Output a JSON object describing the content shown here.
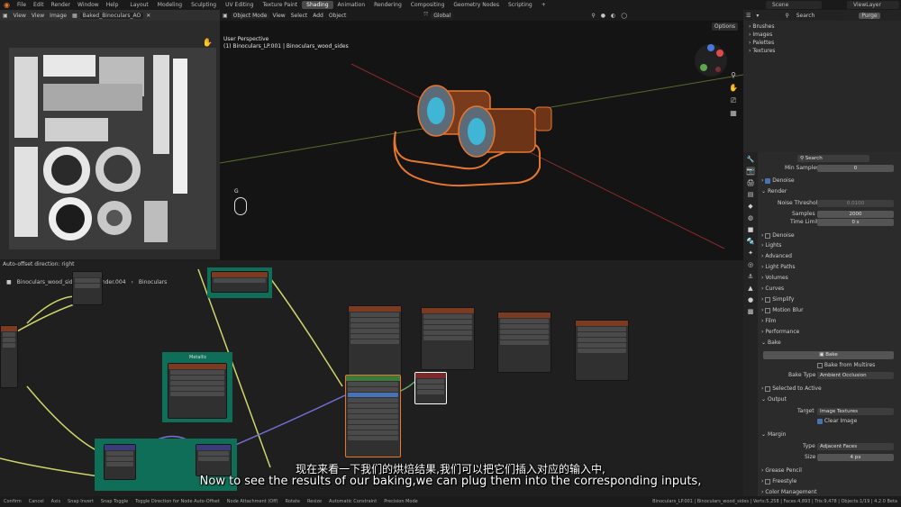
{
  "menu": [
    "File",
    "Edit",
    "Render",
    "Window",
    "Help"
  ],
  "workspaces": [
    "Layout",
    "Modeling",
    "Sculpting",
    "UV Editing",
    "Texture Paint",
    "Shading",
    "Animation",
    "Rendering",
    "Compositing",
    "Geometry Nodes",
    "Scripting"
  ],
  "active_workspace": "Shading",
  "scene_label": "Scene",
  "view_layer_label": "ViewLayer",
  "image_editor": {
    "view_menu": "View",
    "view2": "View",
    "image_menu": "Image",
    "image_name": "Baked_Binoculars_AO"
  },
  "viewport": {
    "mode": "Object Mode",
    "menus": [
      "View",
      "Select",
      "Add",
      "Object"
    ],
    "orientation": "Global",
    "options": "Options",
    "perspective": "User Perspective",
    "object_info": "(1) Binoculars_LP.001 | Binoculars_wood_sides",
    "key_hint": "G"
  },
  "node_editor": {
    "auto_offset": "Auto-offset direction: right",
    "breadcrumbs": [
      "Binoculars_wood_sides",
      "Cylinder.004",
      "Binoculars"
    ],
    "frame_label": "Metallic"
  },
  "outliner": {
    "search_placeholder": "Search",
    "purge": "Purge",
    "items": [
      "Brushes",
      "Images",
      "Palettes",
      "Textures"
    ]
  },
  "properties": {
    "search_placeholder": "Search",
    "min_samples_label": "Min Samples",
    "min_samples_value": "0",
    "denoise": "Denoise",
    "render": "Render",
    "noise_threshold_label": "Noise Threshold",
    "noise_threshold_value": "0.0100",
    "samples_label": "Samples",
    "samples_value": "2000",
    "time_limit_label": "Time Limit",
    "time_limit_value": "0 s",
    "denoise2": "Denoise",
    "lights": "Lights",
    "advanced": "Advanced",
    "light_paths": "Light Paths",
    "volumes": "Volumes",
    "curves": "Curves",
    "simplify": "Simplify",
    "motion_blur": "Motion Blur",
    "film": "Film",
    "performance": "Performance",
    "bake": "Bake",
    "bake_button": "Bake",
    "bake_from_multires": "Bake from Multires",
    "bake_type_label": "Bake Type",
    "bake_type_value": "Ambient Occlusion",
    "selected_to_active": "Selected to Active",
    "output": "Output",
    "target_label": "Target",
    "target_value": "Image Textures",
    "clear_image": "Clear Image",
    "margin": "Margin",
    "type_label": "Type",
    "type_value": "Adjacent Faces",
    "size_label": "Size",
    "size_value": "4 px",
    "grease_pencil": "Grease Pencil",
    "freestyle": "Freestyle",
    "color_management": "Color Management"
  },
  "status": {
    "left": [
      "Confirm",
      "Cancel",
      "Axis",
      "Snap Invert",
      "Snap Toggle",
      "Toggle Direction for Node Auto-Offset",
      "Node Attachment (Off)",
      "Rotate",
      "Resize",
      "Automatic Constraint",
      "Precision Mode"
    ],
    "right": "Binoculars_LP.001 | Binoculars_wood_sides | Verts:5,258 | Faces:4,893 | Tris:9,478 | Objects:1/19 | 4.2.0 Beta"
  },
  "subtitles": {
    "chinese": "现在来看一下我们的烘焙结果,我们可以把它们插入对应的输入中,",
    "english": "Now to see the results of our baking,we can plug them into the corresponding inputs,"
  },
  "colors": {
    "accent_blue": "#4772b3",
    "frame_teal": "#0e6e58",
    "selection_orange": "#e8772e"
  }
}
